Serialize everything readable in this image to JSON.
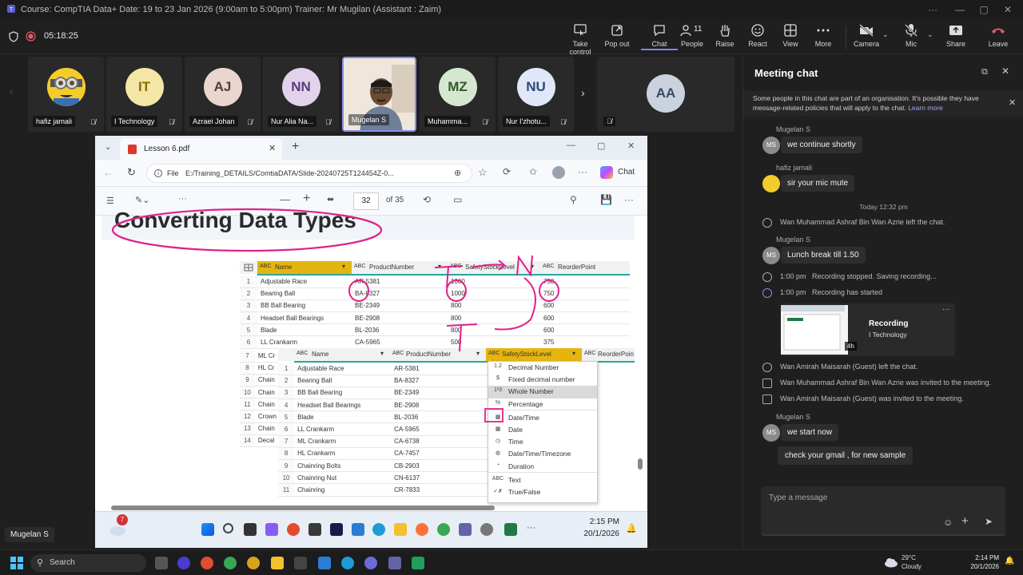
{
  "window": {
    "title": "Course: CompTIA Data+ Date: 19 to 23 Jan 2026 (9:00am to 5:00pm) Trainer: Mr Mugilan (Assistant : Zaim)"
  },
  "toolbar": {
    "timer": "05:18:25",
    "buttons": [
      {
        "label": "Take control",
        "icon": "take-control-icon"
      },
      {
        "label": "Pop out",
        "icon": "pop-out-icon"
      },
      {
        "label": "Chat",
        "icon": "chat-icon"
      },
      {
        "label": "People",
        "icon": "people-icon",
        "count": "11"
      },
      {
        "label": "Raise",
        "icon": "raise-hand-icon"
      },
      {
        "label": "React",
        "icon": "react-icon"
      },
      {
        "label": "View",
        "icon": "view-icon"
      },
      {
        "label": "More",
        "icon": "more-icon"
      },
      {
        "label": "Camera",
        "icon": "camera-off-icon"
      },
      {
        "label": "Mic",
        "icon": "mic-off-icon"
      },
      {
        "label": "Share",
        "icon": "share-icon"
      },
      {
        "label": "Leave",
        "icon": "leave-icon"
      }
    ]
  },
  "participants": [
    {
      "name": "hafiz jamali",
      "initials": "",
      "color": "#5b4a2a"
    },
    {
      "name": "I Technology",
      "initials": "IT",
      "color": "#f3e6a6"
    },
    {
      "name": "Azraei Johan",
      "initials": "AJ",
      "color": "#e8d6cf"
    },
    {
      "name": "Nur Alia Na...",
      "initials": "NN",
      "color": "#e2d2ec"
    },
    {
      "name": "Mugelan S",
      "initials": "",
      "color": "#7a6c5e"
    },
    {
      "name": "Muhamma...",
      "initials": "MZ",
      "color": "#d6e7d0"
    },
    {
      "name": "Nur I'zhotu...",
      "initials": "NU",
      "color": "#dfe7f8"
    },
    {
      "name": "",
      "initials": "AA",
      "color": "#c9d2de"
    }
  ],
  "browser": {
    "tab_title": "Lesson 6.pdf",
    "address_prefix": "File",
    "address": "E:/Training_DETAILS/ComtiaDATA/Slide-20240725T124454Z-0...",
    "chat_button": "Chat",
    "page_current": "32",
    "page_total": "of 35"
  },
  "pdf": {
    "heading": "Converting Data Types",
    "table1": {
      "headers": [
        "Name",
        "ProductNumber",
        "SafetyStockLevel",
        "ReorderPoint"
      ],
      "rows": [
        [
          "1",
          "Adjustable Race",
          "AR-5381",
          "1000",
          "750"
        ],
        [
          "2",
          "Bearing Ball",
          "BA-8327",
          "1000",
          "750"
        ],
        [
          "3",
          "BB Ball Bearing",
          "BE-2349",
          "800",
          "600"
        ],
        [
          "4",
          "Headset Ball Bearings",
          "BE-2908",
          "800",
          "600"
        ],
        [
          "5",
          "Blade",
          "BL-2036",
          "800",
          "600"
        ],
        [
          "6",
          "LL Crankarm",
          "CA-5965",
          "500",
          "375"
        ]
      ],
      "left_rows": [
        [
          "7",
          "ML Cr"
        ],
        [
          "8",
          "HL Cr"
        ],
        [
          "9",
          "Chain"
        ],
        [
          "10",
          "Chain"
        ],
        [
          "11",
          "Chain"
        ],
        [
          "12",
          "Crown"
        ],
        [
          "13",
          "Chain"
        ],
        [
          "14",
          "Decal"
        ]
      ]
    },
    "table2": {
      "headers": [
        "Name",
        "ProductNumber",
        "SafetyStockLevel",
        "ReorderPoin"
      ],
      "rows": [
        [
          "1",
          "Adjustable Race",
          "AR-5381"
        ],
        [
          "2",
          "Bearing Ball",
          "BA-8327"
        ],
        [
          "3",
          "BB Ball Bearing",
          "BE-2349"
        ],
        [
          "4",
          "Headset Ball Bearings",
          "BE-2908"
        ],
        [
          "5",
          "Blade",
          "BL-2036"
        ],
        [
          "6",
          "LL Crankarm",
          "CA-5965"
        ],
        [
          "7",
          "ML Crankarm",
          "CA-6738"
        ],
        [
          "8",
          "HL Crankarm",
          "CA-7457"
        ],
        [
          "9",
          "Chainring Bolts",
          "CB-2903"
        ],
        [
          "10",
          "Chainring Nut",
          "CN-6137"
        ],
        [
          "11",
          "Chainring",
          "CR-7833"
        ]
      ]
    },
    "type_menu": [
      {
        "icon": "1.2",
        "label": "Decimal Number"
      },
      {
        "icon": "$",
        "label": "Fixed decimal number"
      },
      {
        "icon": "1²3",
        "label": "Whole Number"
      },
      {
        "icon": "%",
        "label": "Percentage"
      },
      {
        "icon": "cal",
        "label": "Date/Time"
      },
      {
        "icon": "cal",
        "label": "Date"
      },
      {
        "icon": "clk",
        "label": "Time"
      },
      {
        "icon": "glb",
        "label": "Date/Time/Timezone"
      },
      {
        "icon": "dur",
        "label": "Duration"
      },
      {
        "icon": "ABC",
        "label": "Text"
      },
      {
        "icon": "tf",
        "label": "True/False"
      }
    ],
    "annotation_letters": [
      "T",
      "N"
    ]
  },
  "remote_taskbar": {
    "badge": "7",
    "time": "2:15 PM",
    "date": "20/1/2026"
  },
  "presenter_label": "Mugelan S",
  "chat": {
    "title": "Meeting chat",
    "notice": "Some people in this chat are part of an organisation. It's possible they have message-related policies that will apply to the chat.",
    "learn_more": "Learn more",
    "day_divider": "Today 12:32 pm",
    "messages": [
      {
        "sender": "Mugelan S",
        "initials": "MS",
        "text": "we continue shortly"
      },
      {
        "sender": "hafiz jamali",
        "initials": "",
        "text": "sir your mic mute"
      },
      {
        "sender": "Mugelan S",
        "initials": "MS",
        "text": "Lunch break till 1.50"
      },
      {
        "sender": "Mugelan S",
        "initials": "MS",
        "text": "we start now"
      },
      {
        "sender": "",
        "initials": "",
        "text": "check your gmail , for new sample"
      }
    ],
    "events": [
      {
        "time": "",
        "text": "Wan Muhammad Ashraf Bin Wan Azrie left the chat."
      },
      {
        "time": "1:00 pm",
        "text": "Recording stopped. Saving recording..."
      },
      {
        "time": "1:00 pm",
        "text": "Recording has started"
      },
      {
        "time": "",
        "text": "Wan Amirah Maisarah (Guest) left the chat."
      },
      {
        "time": "",
        "text": "Wan Muhammad Ashraf Bin Wan Azrie was invited to the meeting."
      },
      {
        "time": "",
        "text": "Wan Amirah Maisarah (Guest) was invited to the meeting."
      }
    ],
    "recording": {
      "title": "Recording",
      "subtitle": "I Technology",
      "duration": "4h"
    },
    "composer_placeholder": "Type a message"
  },
  "os_taskbar": {
    "search": "Search",
    "weather_temp": "29°C",
    "weather_desc": "Cloudy",
    "time": "2:14 PM",
    "date": "20/1/2026"
  },
  "colors": {
    "accent": "#7f85f5",
    "leave": "#c4314b",
    "annotation": "#e0218a",
    "header_yellow": "#e5b50f",
    "header_teal": "#2ba5a0"
  }
}
